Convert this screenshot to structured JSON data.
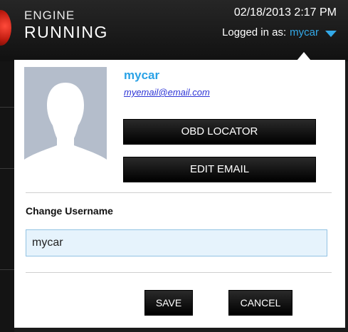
{
  "header": {
    "brand_line1": "ENGINE",
    "brand_line2": "RUNNING",
    "datetime": "02/18/2013 2:17 PM",
    "logged_in_label": "Logged in as:",
    "logged_in_user": "mycar",
    "accent_color": "#33a9e8"
  },
  "profile": {
    "username": "mycar",
    "email": "myemail@email.com",
    "avatar_icon": "user-silhouette-icon"
  },
  "actions": {
    "obd_locator_label": "OBD LOCATOR",
    "edit_email_label": "EDIT EMAIL"
  },
  "change_username": {
    "label": "Change Username",
    "value": "mycar"
  },
  "footer": {
    "save_label": "SAVE",
    "cancel_label": "CANCEL"
  }
}
